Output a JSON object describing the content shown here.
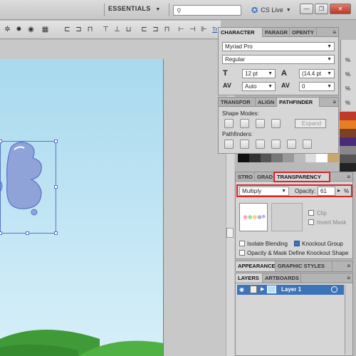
{
  "topbar": {
    "workspace_label": "ESSENTIALS",
    "search_placeholder": "",
    "cs_live_label": "CS Live",
    "window_buttons": {
      "minimize": "—",
      "restore": "❐",
      "close": "✕"
    }
  },
  "control_bar": {
    "link_label": "Tr"
  },
  "character_panel": {
    "tabs": [
      "CHARACTER",
      "PARAGR",
      "OPENTY"
    ],
    "font_family": "Myriad Pro",
    "font_style": "Regular",
    "font_size": "12 pt",
    "leading": "(14.4 pt",
    "kerning": "Auto",
    "tracking": "0"
  },
  "pathfinder_panel": {
    "tabs": [
      "TRANSFOR",
      "ALIGN",
      "PATHFINDER"
    ],
    "shape_modes_label": "Shape Modes:",
    "expand_label": "Expand",
    "pathfinders_label": "Pathfinders:"
  },
  "transparency_panel": {
    "tabs": [
      "STRO",
      "GRAD",
      "TRANSPARENCY"
    ],
    "blend_mode": "Multiply",
    "opacity_label": "Opacity:",
    "opacity_value": "61",
    "percent_label": "%",
    "clip_label": "Clip",
    "invert_mask_label": "Invert Mask",
    "isolate_blending_label": "Isolate Blending",
    "knockout_group_label": "Knockout Group",
    "opacity_mask_label": "Opacity & Mask Define Knockout Shape"
  },
  "appearance_panel": {
    "tabs": [
      "APPEARANCE",
      "GRAPHIC STYLES"
    ]
  },
  "layers_panel": {
    "tabs": [
      "LAYERS",
      "ARTBOARDS"
    ],
    "layer_name": "Layer 1"
  },
  "right_strip": {
    "percent_labels": [
      "%",
      "%",
      "%",
      "%"
    ]
  },
  "colors": {
    "accent_red": "#d8262a",
    "layer_highlight": "#3d73b8",
    "selection_blue": "#5a72c8"
  }
}
